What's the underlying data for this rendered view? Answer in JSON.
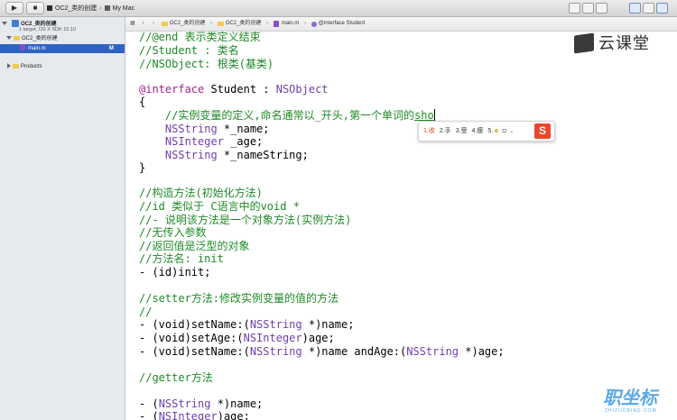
{
  "toolbar": {
    "scheme_target": "OC2_类的创建",
    "scheme_device": "My Mac"
  },
  "navigator": {
    "project_name": "OC2_类的创建",
    "project_sub": "1 target, OS X SDK 10.10",
    "group_name": "OC2_类的创建",
    "file_name": "main.m",
    "file_badge": "M",
    "products": "Products"
  },
  "jumpbar": {
    "crumbs": [
      "OC2_类的创建",
      "OC2_类的创建",
      "main.m",
      "@interface Student"
    ]
  },
  "code": {
    "l1": "//@end 表示类定义结束",
    "l2": "//Student : 类名",
    "l3": "//NSObject: 根类(基类)",
    "l4_kw": "@interface",
    "l4_mid": " Student : ",
    "l4_type": "NSObject",
    "l5": "{",
    "l6_a": "    //实例变量的定义,命名通常以_开头,第一个单词的",
    "l6_b": "sho",
    "l7_type": "NSString",
    "l7_rest": " *_name;",
    "l8_type": "NSInteger",
    "l8_rest": " _age;",
    "l9_type": "NSString",
    "l9_rest": " *_nameString;",
    "l10": "}",
    "l11": "//构造方法(初始化方法)",
    "l12": "//id 类似于 C语言中的void *",
    "l13": "//- 说明该方法是一个对象方法(实例方法)",
    "l14": "//无传入参数",
    "l15": "//返回值是泛型的对象",
    "l16": "//方法名: init",
    "l17": "- (id)init;",
    "l18": "//setter方法:修改实例变量的值的方法",
    "l19": "//",
    "l20_a": "- (void)setName:(",
    "l20_t": "NSString",
    "l20_b": " *)name;",
    "l21_a": "- (void)setAge:(",
    "l21_t": "NSInteger",
    "l21_b": ")age;",
    "l22_a": "- (void)setName:(",
    "l22_t": "NSString",
    "l22_b": " *)name andAge:(",
    "l22_t2": "NSString",
    "l22_c": " *)age;",
    "l23": "//getter方法",
    "l24_a": "- (",
    "l24_t": "NSString",
    "l24_b": " *)name;",
    "l25_a": "- (",
    "l25_t": "NSInteger",
    "l25_b": ")age;"
  },
  "ime": {
    "c1": "1.收",
    "c2": "2.手",
    "c3": "3.受",
    "c4": "4.瘦",
    "c5": "5.",
    "logo": "S"
  },
  "watermark": {
    "text": "云课堂",
    "text2": "职坐标",
    "text2_sub": "ZHIZUOBIAO.COM"
  }
}
